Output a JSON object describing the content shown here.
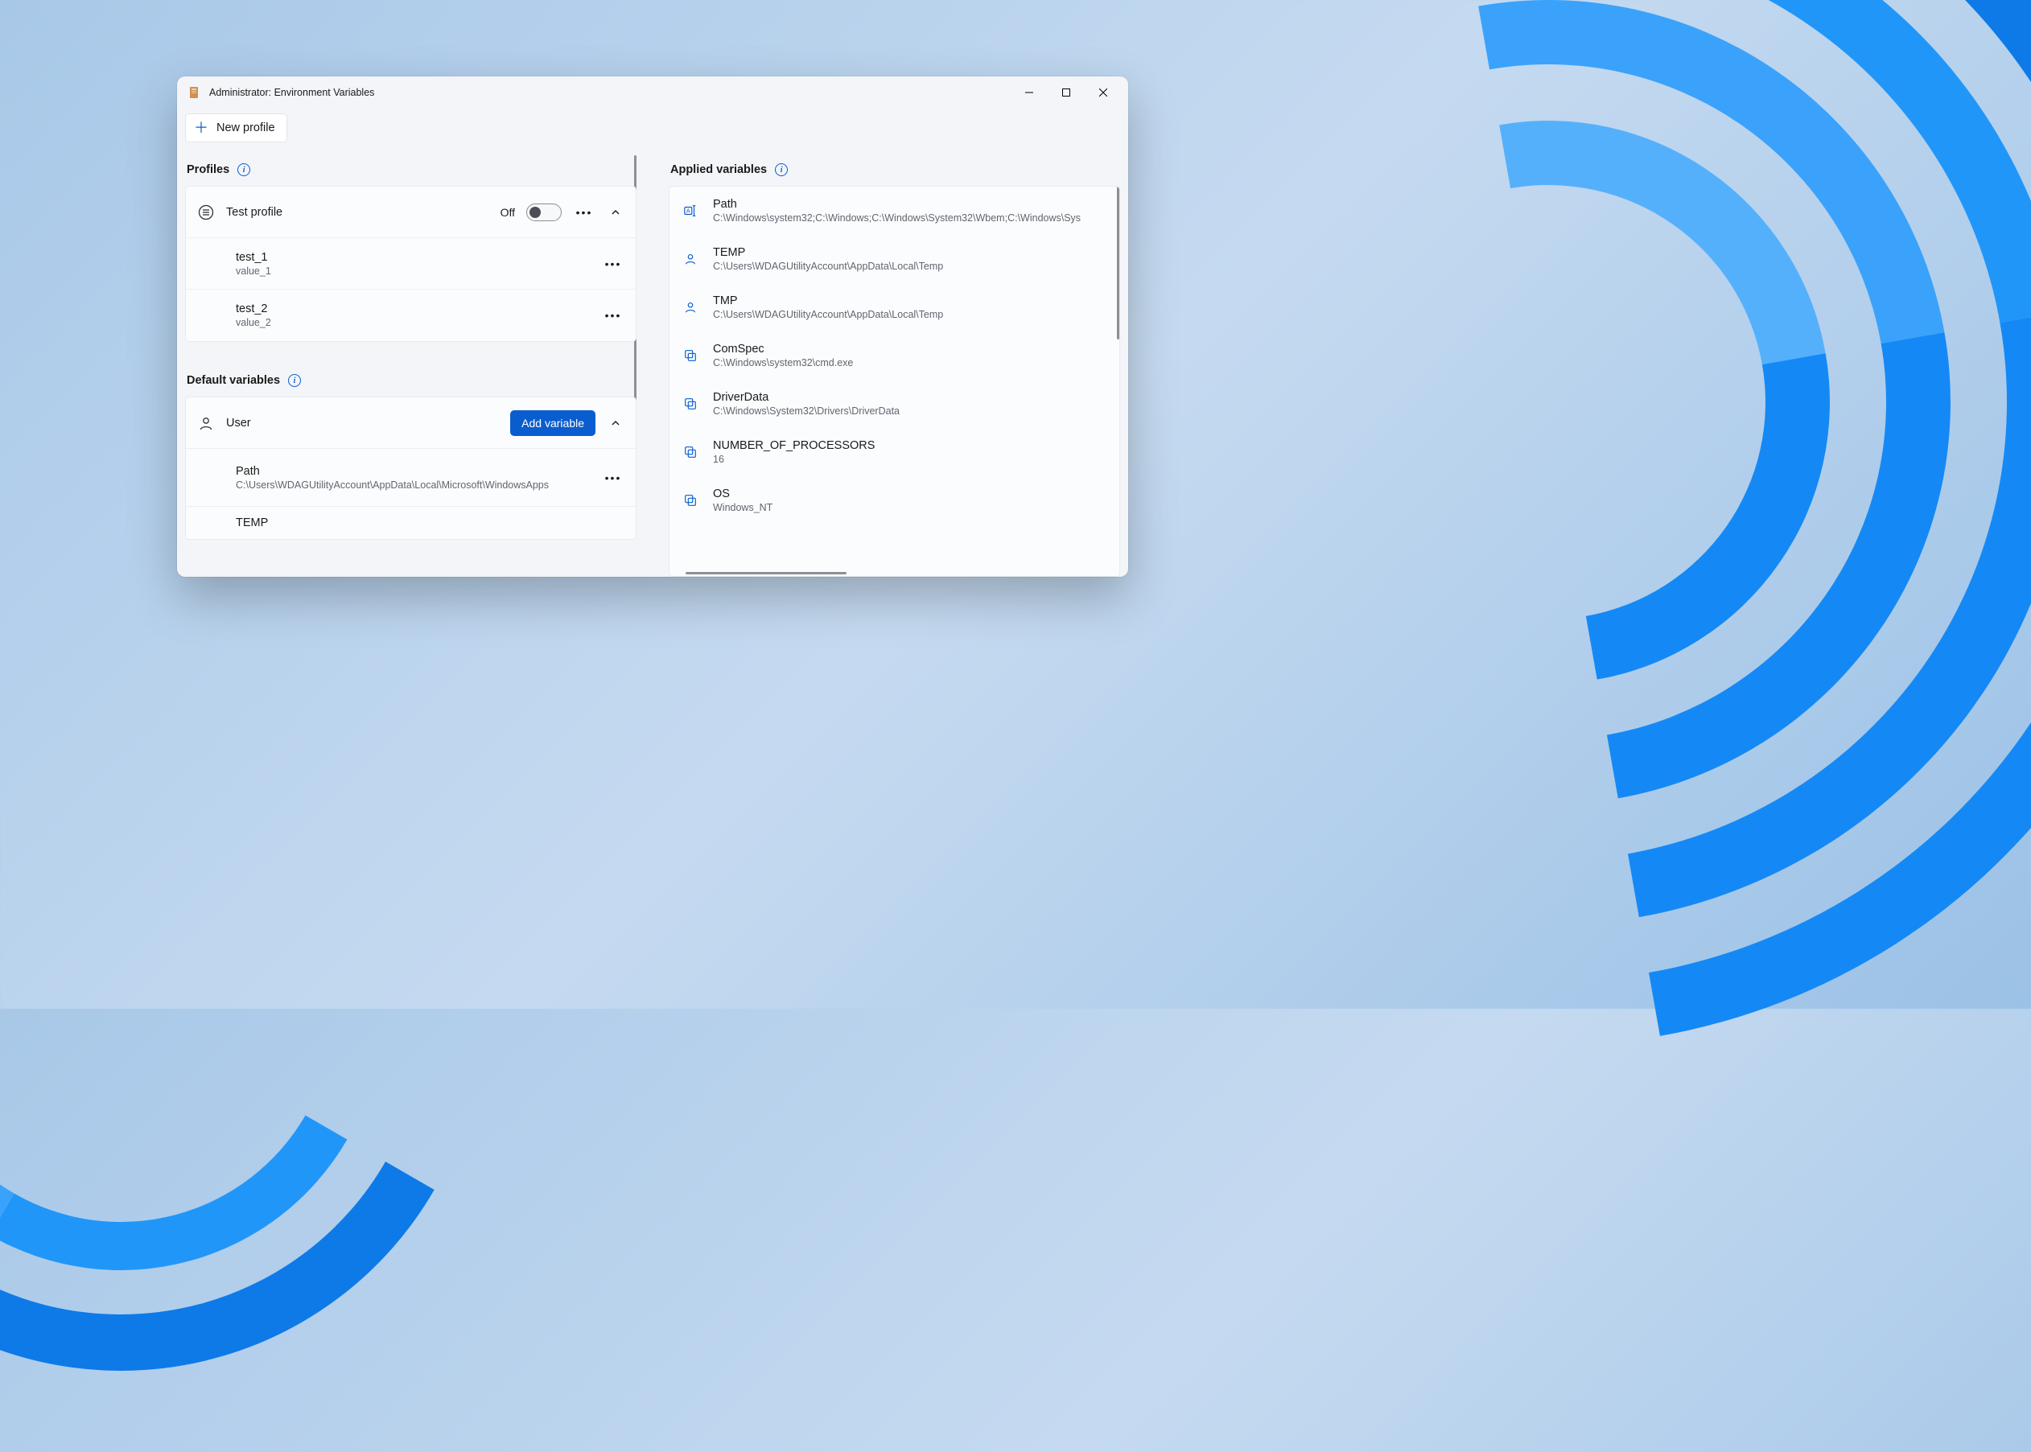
{
  "window": {
    "title": "Administrator: Environment Variables"
  },
  "toolbar": {
    "new_profile": "New profile"
  },
  "profiles": {
    "heading": "Profiles",
    "item": {
      "name": "Test profile",
      "toggle_label": "Off"
    },
    "vars": [
      {
        "name": "test_1",
        "value": "value_1"
      },
      {
        "name": "test_2",
        "value": "value_2"
      }
    ]
  },
  "defaults": {
    "heading": "Default variables",
    "user": {
      "label": "User",
      "add_button": "Add variable",
      "vars": [
        {
          "name": "Path",
          "value": "C:\\Users\\WDAGUtilityAccount\\AppData\\Local\\Microsoft\\WindowsApps"
        },
        {
          "name": "TEMP",
          "value": ""
        }
      ]
    }
  },
  "applied": {
    "heading": "Applied variables",
    "vars": [
      {
        "name": "Path",
        "value": "C:\\Windows\\system32;C:\\Windows;C:\\Windows\\System32\\Wbem;C:\\Windows\\Sys",
        "icon": "rename"
      },
      {
        "name": "TEMP",
        "value": "C:\\Users\\WDAGUtilityAccount\\AppData\\Local\\Temp",
        "icon": "user"
      },
      {
        "name": "TMP",
        "value": "C:\\Users\\WDAGUtilityAccount\\AppData\\Local\\Temp",
        "icon": "user"
      },
      {
        "name": "ComSpec",
        "value": "C:\\Windows\\system32\\cmd.exe",
        "icon": "system"
      },
      {
        "name": "DriverData",
        "value": "C:\\Windows\\System32\\Drivers\\DriverData",
        "icon": "system"
      },
      {
        "name": "NUMBER_OF_PROCESSORS",
        "value": "16",
        "icon": "system"
      },
      {
        "name": "OS",
        "value": "Windows_NT",
        "icon": "system"
      }
    ]
  }
}
